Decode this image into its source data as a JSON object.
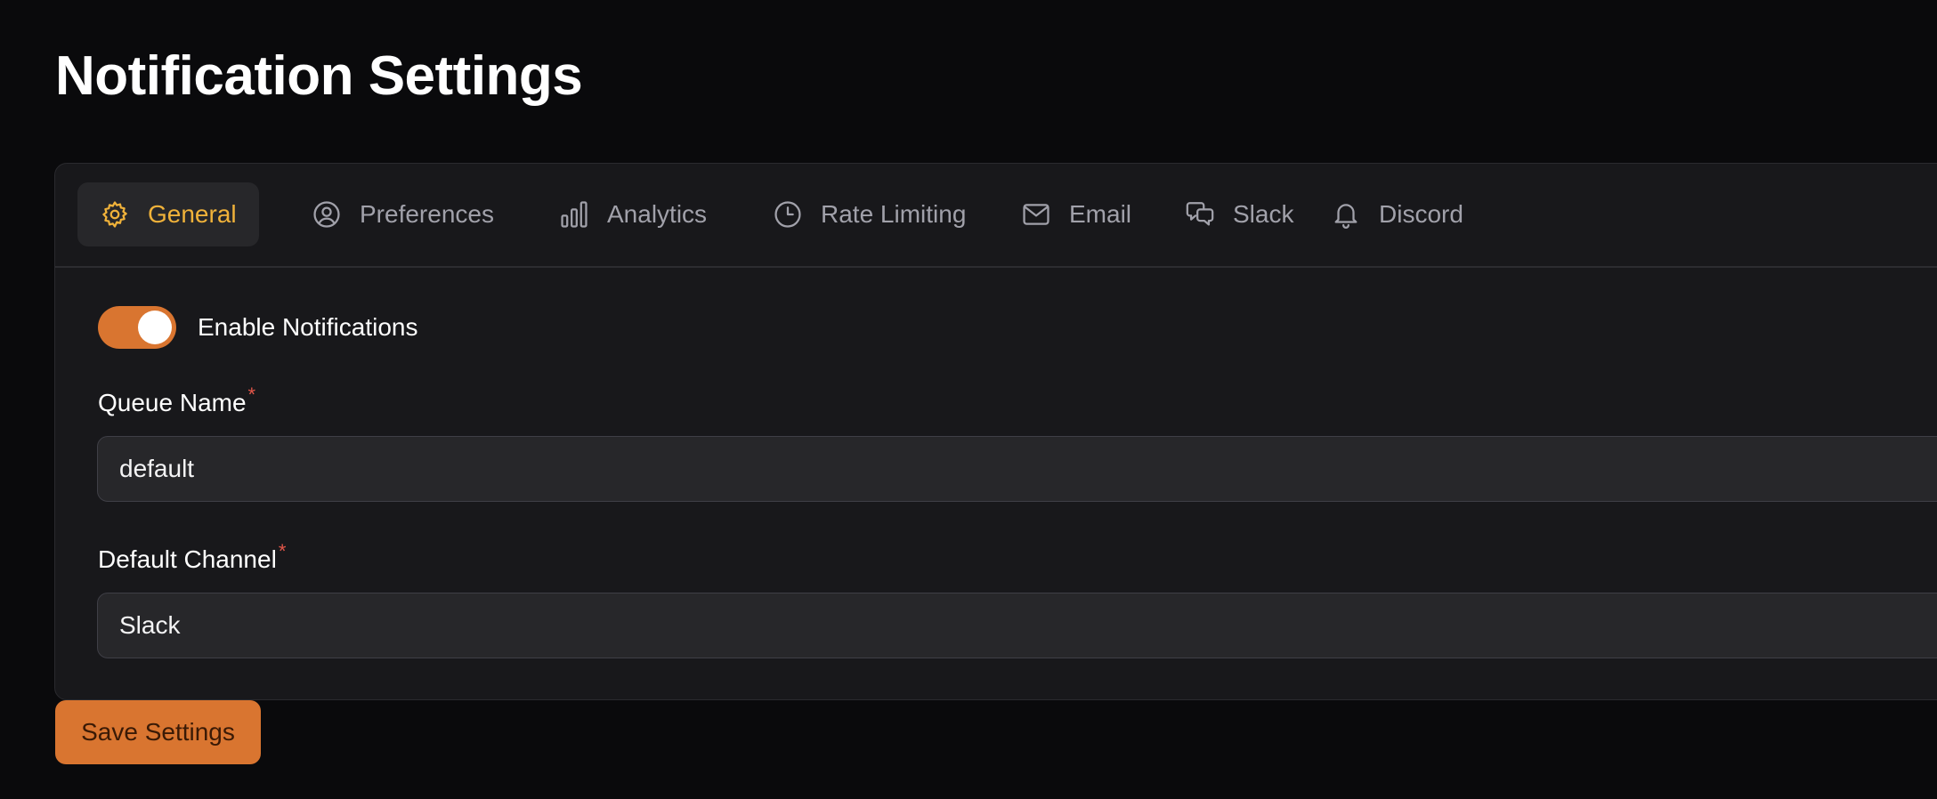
{
  "page": {
    "title": "Notification Settings"
  },
  "tabs": [
    {
      "label": "General",
      "icon": "gear-icon",
      "active": true
    },
    {
      "label": "Preferences",
      "icon": "user-circle-icon",
      "active": false
    },
    {
      "label": "Analytics",
      "icon": "bar-chart-icon",
      "active": false
    },
    {
      "label": "Rate Limiting",
      "icon": "clock-icon",
      "active": false
    },
    {
      "label": "Email",
      "icon": "mail-icon",
      "active": false
    },
    {
      "label": "Slack",
      "icon": "chat-bubbles-icon",
      "active": false
    },
    {
      "label": "Discord",
      "icon": "bell-icon",
      "active": false
    }
  ],
  "general": {
    "enable_notifications": {
      "label": "Enable Notifications",
      "enabled": true
    },
    "queue_name": {
      "label": "Queue Name",
      "required_mark": "*",
      "value": "default"
    },
    "default_channel": {
      "label": "Default Channel",
      "required_mark": "*",
      "value": "Slack"
    }
  },
  "actions": {
    "save_label": "Save Settings"
  },
  "colors": {
    "accent": "#d97530",
    "active_tab_text": "#f0b23a",
    "background": "#0a0a0c",
    "card": "#18181b",
    "required": "#e4574a"
  }
}
